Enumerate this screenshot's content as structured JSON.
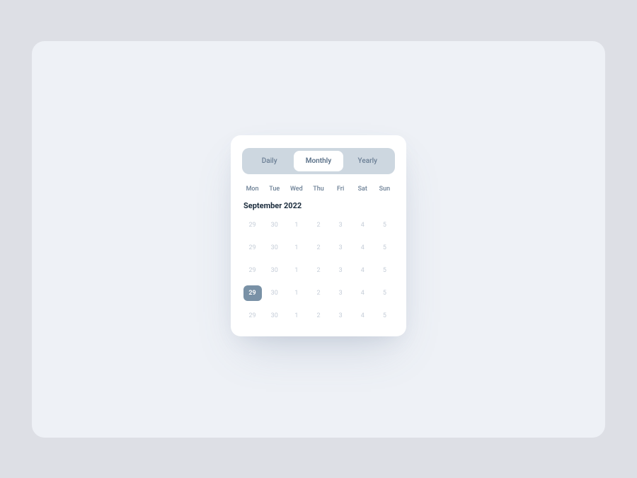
{
  "tabs": {
    "daily": "Daily",
    "monthly": "Monthly",
    "yearly": "Yearly",
    "active": "monthly"
  },
  "weekdays": [
    "Mon",
    "Tue",
    "Wed",
    "Thu",
    "Fri",
    "Sat",
    "Sun"
  ],
  "month_label": "September 2022",
  "days": [
    {
      "value": "29",
      "selected": false
    },
    {
      "value": "30",
      "selected": false
    },
    {
      "value": "1",
      "selected": false
    },
    {
      "value": "2",
      "selected": false
    },
    {
      "value": "3",
      "selected": false
    },
    {
      "value": "4",
      "selected": false
    },
    {
      "value": "5",
      "selected": false
    },
    {
      "value": "29",
      "selected": false
    },
    {
      "value": "30",
      "selected": false
    },
    {
      "value": "1",
      "selected": false
    },
    {
      "value": "2",
      "selected": false
    },
    {
      "value": "3",
      "selected": false
    },
    {
      "value": "4",
      "selected": false
    },
    {
      "value": "5",
      "selected": false
    },
    {
      "value": "29",
      "selected": false
    },
    {
      "value": "30",
      "selected": false
    },
    {
      "value": "1",
      "selected": false
    },
    {
      "value": "2",
      "selected": false
    },
    {
      "value": "3",
      "selected": false
    },
    {
      "value": "4",
      "selected": false
    },
    {
      "value": "5",
      "selected": false
    },
    {
      "value": "29",
      "selected": true
    },
    {
      "value": "30",
      "selected": false
    },
    {
      "value": "1",
      "selected": false
    },
    {
      "value": "2",
      "selected": false
    },
    {
      "value": "3",
      "selected": false
    },
    {
      "value": "4",
      "selected": false
    },
    {
      "value": "5",
      "selected": false
    },
    {
      "value": "29",
      "selected": false
    },
    {
      "value": "30",
      "selected": false
    },
    {
      "value": "1",
      "selected": false
    },
    {
      "value": "2",
      "selected": false
    },
    {
      "value": "3",
      "selected": false
    },
    {
      "value": "4",
      "selected": false
    },
    {
      "value": "5",
      "selected": false
    }
  ]
}
